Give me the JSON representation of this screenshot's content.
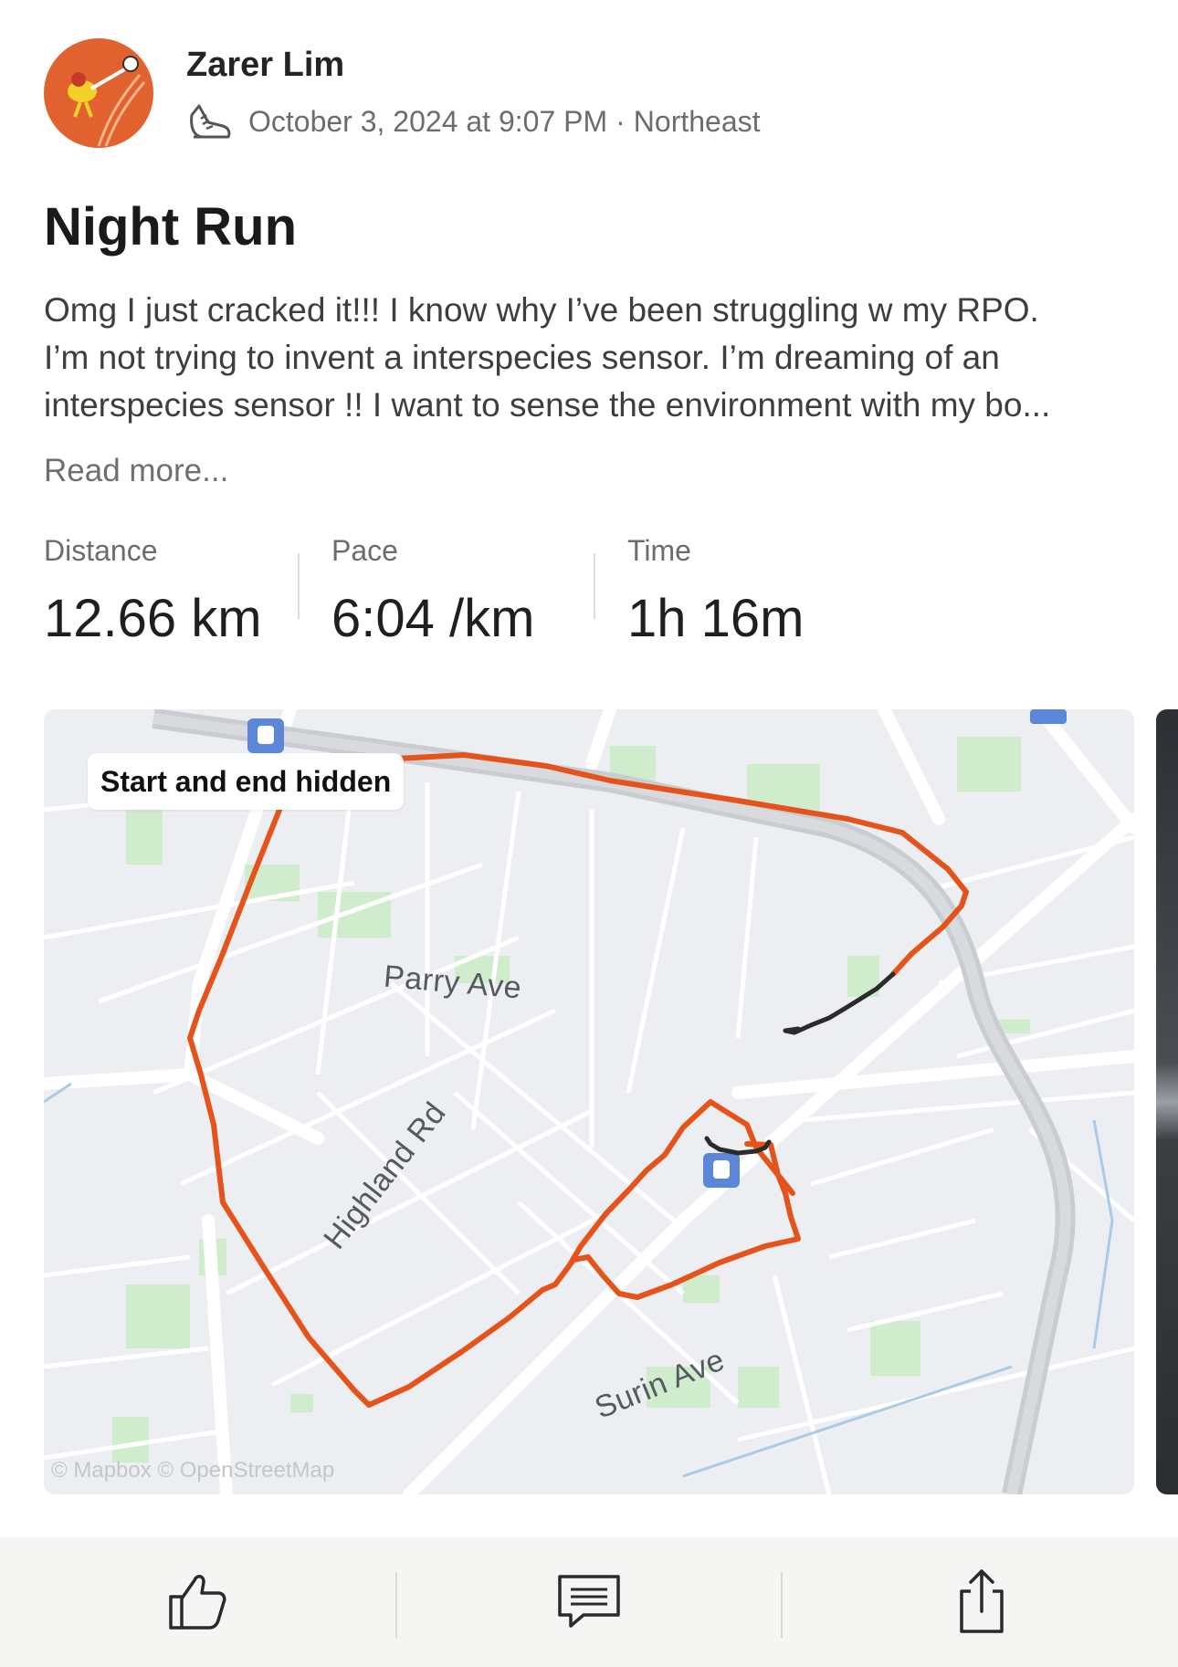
{
  "post": {
    "author": "Zarer Lim",
    "date": "October 3, 2024 at 9:07 PM",
    "separator": "·",
    "location": "Northeast",
    "activity_icon": "running-shoe-icon",
    "title": "Night Run",
    "description": "Omg I just cracked it!!! I know why I’ve been struggling w my RPO.\nI’m not trying to invent a interspecies sensor. I’m dreaming of an\ninterspecies sensor !! I want to sense the environment with my bo...",
    "read_more": "Read more..."
  },
  "stats": {
    "distance": {
      "label": "Distance",
      "value": "12.66 km"
    },
    "pace": {
      "label": "Pace",
      "value": "6:04 /km"
    },
    "time": {
      "label": "Time",
      "value": "1h 16m"
    }
  },
  "map": {
    "badge": "Start and end hidden",
    "streets": [
      "Parry Ave",
      "Highland Rd",
      "Surin Ave"
    ],
    "attribution": "© Mapbox © OpenStreetMap",
    "route_color": "#e5531a",
    "hidden_segment_color": "#2b2b2b"
  },
  "actions": {
    "like_icon": "thumbs-up-icon",
    "comment_icon": "comment-icon",
    "share_icon": "share-icon"
  },
  "colors": {
    "avatar_bg": "#e1622f",
    "map_bg": "#eceef1",
    "park_green": "#cfeccd",
    "action_bar_bg": "#f5f5f3"
  }
}
